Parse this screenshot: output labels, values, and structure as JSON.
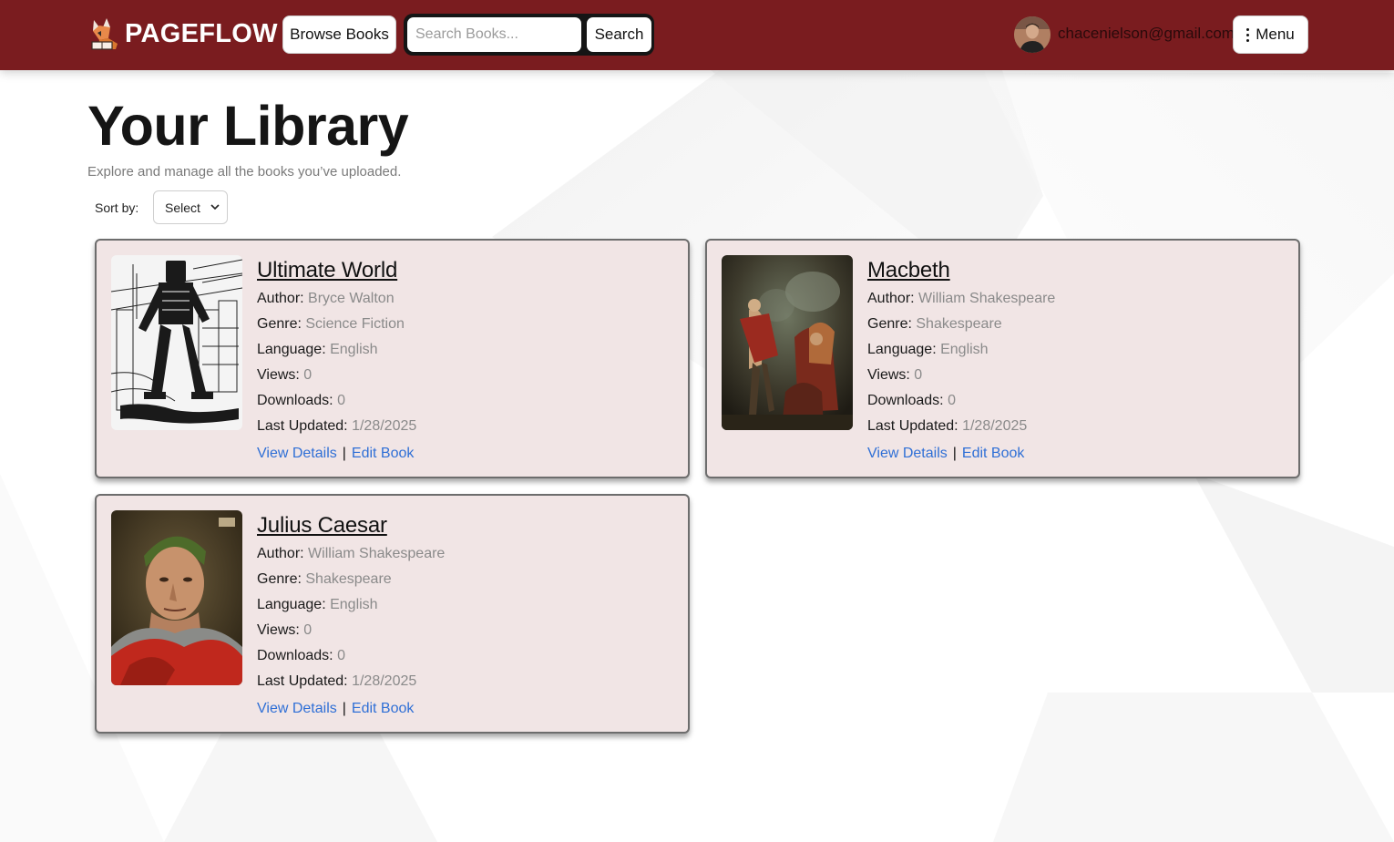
{
  "navbar": {
    "brand": "PAGEFLOW",
    "browse_label": "Browse Books",
    "search_placeholder": "Search Books...",
    "search_label": "Search",
    "user_email": "chacenielson@gmail.com",
    "menu_label": "Menu",
    "bg_color": "#7a1c1f"
  },
  "header": {
    "title": "Your Library",
    "subtitle": "Explore and manage all the books you’ve uploaded.",
    "sort_label": "Sort by:",
    "sort_value": "Select"
  },
  "labels": {
    "author": "Author:",
    "genre": "Genre:",
    "language": "Language:",
    "views": "Views:",
    "downloads": "Downloads:",
    "last_updated": "Last Updated:",
    "view_details": "View Details",
    "edit_book": "Edit Book",
    "separator": "|"
  },
  "books": [
    {
      "title": "Ultimate World",
      "author": "Bryce Walton",
      "genre": "Science Fiction",
      "language": "English",
      "views": "0",
      "downloads": "0",
      "last_updated": "1/28/2025",
      "cover": "robot-city-illustration"
    },
    {
      "title": "Macbeth",
      "author": "William Shakespeare",
      "genre": "Shakespeare",
      "language": "English",
      "views": "0",
      "downloads": "0",
      "last_updated": "1/28/2025",
      "cover": "macbeth-painting"
    },
    {
      "title": "Julius Caesar",
      "author": "William Shakespeare",
      "genre": "Shakespeare",
      "language": "English",
      "views": "0",
      "downloads": "0",
      "last_updated": "1/28/2025",
      "cover": "caesar-portrait"
    }
  ],
  "colors": {
    "card_bg": "#f1e5e5",
    "link": "#2f6fd6",
    "accent": "#7a1c1f"
  }
}
